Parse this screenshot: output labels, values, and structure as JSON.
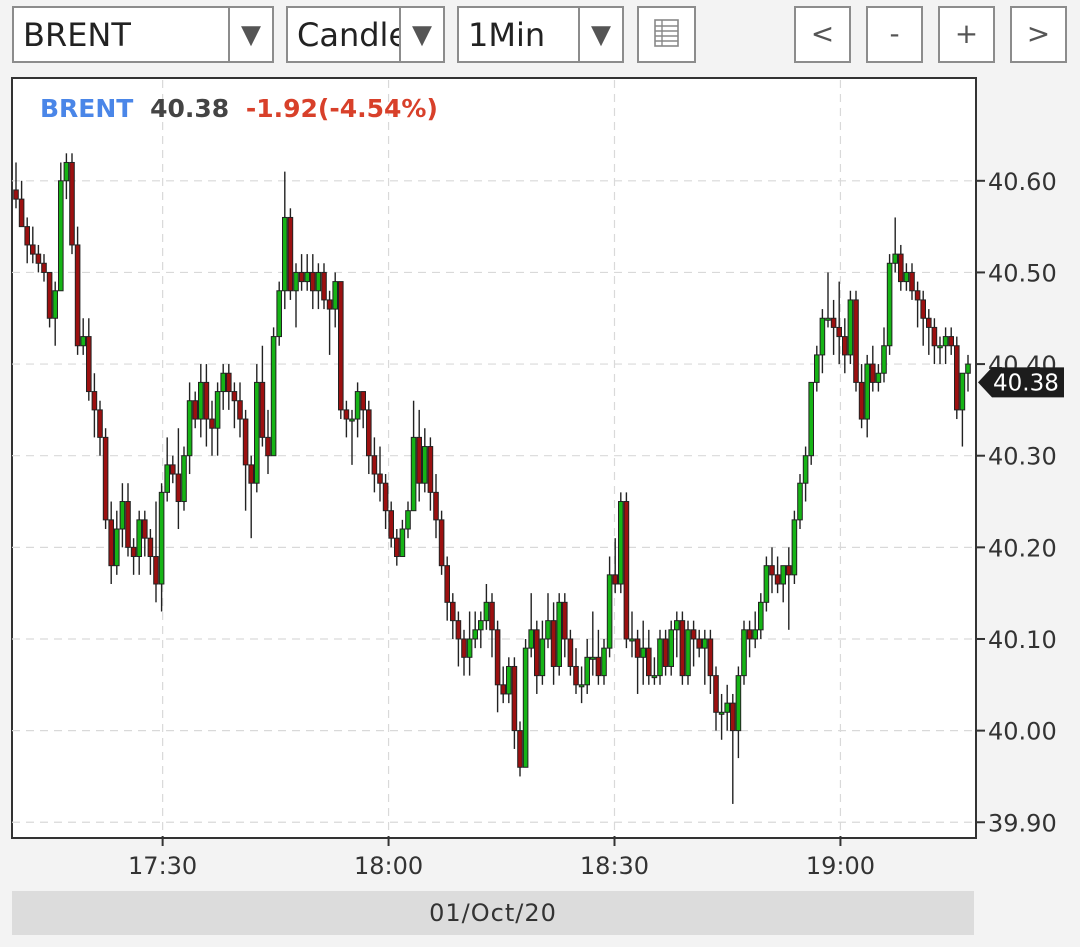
{
  "toolbar": {
    "symbol": "BRENT",
    "chart_type": "Candle",
    "interval": "1Min",
    "nav": {
      "prev": "<",
      "zoom_out": "-",
      "zoom_in": "+",
      "next": ">"
    },
    "dropdown_glyph": "▼"
  },
  "header": {
    "symbol": "BRENT",
    "price": "40.38",
    "change": "-1.92(-4.54%)"
  },
  "date_label": "01/Oct/20",
  "colors": {
    "up": "#16b416",
    "down": "#9c1010",
    "symbol": "#4a86e8",
    "change": "#d8402a",
    "price": "#444444"
  },
  "icons": {
    "table": "table-icon",
    "dropdown": "chevron-down-icon"
  },
  "chart_data": {
    "type": "candlestick",
    "symbol": "BRENT",
    "last_price": 40.38,
    "last_price_label": "40.38",
    "x_ticks": [
      "17:30",
      "18:00",
      "18:30",
      "19:00"
    ],
    "x_ticks_minutes": [
      1050,
      1080,
      1110,
      1140
    ],
    "x_range_minutes": [
      1030,
      1158
    ],
    "y_ticks": [
      39.9,
      40.0,
      40.1,
      40.2,
      40.3,
      40.4,
      40.5,
      40.6
    ],
    "y_tick_labels": [
      "39.90",
      "40.00",
      "40.10",
      "40.20",
      "40.30",
      "40.40",
      "40.50",
      "40.60"
    ],
    "ylim": [
      39.885,
      40.71
    ],
    "grid": true,
    "candles": [
      [
        40.59,
        40.62,
        40.57,
        40.58
      ],
      [
        40.58,
        40.6,
        40.55,
        40.55
      ],
      [
        40.55,
        40.56,
        40.51,
        40.53
      ],
      [
        40.53,
        40.55,
        40.51,
        40.52
      ],
      [
        40.52,
        40.53,
        40.5,
        40.51
      ],
      [
        40.51,
        40.52,
        40.49,
        40.5
      ],
      [
        40.5,
        40.5,
        40.44,
        40.45
      ],
      [
        40.45,
        40.49,
        40.42,
        40.48
      ],
      [
        40.48,
        40.62,
        40.48,
        40.6
      ],
      [
        40.6,
        40.63,
        40.58,
        40.62
      ],
      [
        40.62,
        40.63,
        40.52,
        40.53
      ],
      [
        40.53,
        40.55,
        40.41,
        40.42
      ],
      [
        40.42,
        40.45,
        40.41,
        40.43
      ],
      [
        40.43,
        40.45,
        40.36,
        40.37
      ],
      [
        40.37,
        40.39,
        40.32,
        40.35
      ],
      [
        40.35,
        40.36,
        40.3,
        40.32
      ],
      [
        40.32,
        40.33,
        40.22,
        40.23
      ],
      [
        40.23,
        40.25,
        40.16,
        40.18
      ],
      [
        40.18,
        40.24,
        40.17,
        40.22
      ],
      [
        40.22,
        40.27,
        40.2,
        40.25
      ],
      [
        40.25,
        40.27,
        40.19,
        40.2
      ],
      [
        40.2,
        40.21,
        40.17,
        40.19
      ],
      [
        40.19,
        40.24,
        40.17,
        40.23
      ],
      [
        40.23,
        40.24,
        40.19,
        40.21
      ],
      [
        40.21,
        40.22,
        40.17,
        40.19
      ],
      [
        40.19,
        40.25,
        40.14,
        40.16
      ],
      [
        40.16,
        40.27,
        40.13,
        40.26
      ],
      [
        40.26,
        40.32,
        40.25,
        40.29
      ],
      [
        40.29,
        40.3,
        40.27,
        40.28
      ],
      [
        40.28,
        40.33,
        40.22,
        40.25
      ],
      [
        40.25,
        40.31,
        40.24,
        40.3
      ],
      [
        40.3,
        40.38,
        40.28,
        40.36
      ],
      [
        40.36,
        40.37,
        40.33,
        40.34
      ],
      [
        40.34,
        40.4,
        40.32,
        40.38
      ],
      [
        40.38,
        40.4,
        40.31,
        40.34
      ],
      [
        40.34,
        40.36,
        40.3,
        40.33
      ],
      [
        40.33,
        40.38,
        40.3,
        40.37
      ],
      [
        40.37,
        40.4,
        40.35,
        40.39
      ],
      [
        40.39,
        40.4,
        40.35,
        40.37
      ],
      [
        40.37,
        40.38,
        40.33,
        40.36
      ],
      [
        40.36,
        40.38,
        40.32,
        40.34
      ],
      [
        40.34,
        40.35,
        40.24,
        40.29
      ],
      [
        40.29,
        40.3,
        40.21,
        40.27
      ],
      [
        40.27,
        40.4,
        40.26,
        40.38
      ],
      [
        40.38,
        40.42,
        40.31,
        40.32
      ],
      [
        40.32,
        40.35,
        40.28,
        40.3
      ],
      [
        40.3,
        40.44,
        40.3,
        40.43
      ],
      [
        40.43,
        40.49,
        40.42,
        40.48
      ],
      [
        40.48,
        40.61,
        40.46,
        40.56
      ],
      [
        40.56,
        40.57,
        40.47,
        40.48
      ],
      [
        40.48,
        40.51,
        40.44,
        40.5
      ],
      [
        40.5,
        40.52,
        40.48,
        40.49
      ],
      [
        40.49,
        40.52,
        40.48,
        40.5
      ],
      [
        40.5,
        40.52,
        40.46,
        40.48
      ],
      [
        40.48,
        40.51,
        40.46,
        40.5
      ],
      [
        40.5,
        40.51,
        40.46,
        40.47
      ],
      [
        40.47,
        40.48,
        40.41,
        40.46
      ],
      [
        40.46,
        40.5,
        40.44,
        40.49
      ],
      [
        40.49,
        40.49,
        40.34,
        40.35
      ],
      [
        40.35,
        40.36,
        40.32,
        40.34
      ],
      [
        40.34,
        40.35,
        40.29,
        40.34
      ],
      [
        40.34,
        40.38,
        40.32,
        40.37
      ],
      [
        40.37,
        40.37,
        40.33,
        40.35
      ],
      [
        40.35,
        40.36,
        40.28,
        40.3
      ],
      [
        40.3,
        40.32,
        40.26,
        40.28
      ],
      [
        40.28,
        40.31,
        40.25,
        40.27
      ],
      [
        40.27,
        40.28,
        40.22,
        40.24
      ],
      [
        40.24,
        40.25,
        40.2,
        40.21
      ],
      [
        40.21,
        40.22,
        40.18,
        40.19
      ],
      [
        40.19,
        40.23,
        40.19,
        40.22
      ],
      [
        40.22,
        40.25,
        40.21,
        40.24
      ],
      [
        40.24,
        40.36,
        40.24,
        40.32
      ],
      [
        40.32,
        40.35,
        40.25,
        40.27
      ],
      [
        40.27,
        40.33,
        40.26,
        40.31
      ],
      [
        40.31,
        40.32,
        40.24,
        40.26
      ],
      [
        40.26,
        40.28,
        40.21,
        40.23
      ],
      [
        40.23,
        40.24,
        40.17,
        40.18
      ],
      [
        40.18,
        40.19,
        40.12,
        40.14
      ],
      [
        40.14,
        40.15,
        40.1,
        40.12
      ],
      [
        40.12,
        40.13,
        40.07,
        40.1
      ],
      [
        40.1,
        40.11,
        40.06,
        40.08
      ],
      [
        40.08,
        40.13,
        40.06,
        40.1
      ],
      [
        40.1,
        40.13,
        40.09,
        40.11
      ],
      [
        40.11,
        40.13,
        40.09,
        40.12
      ],
      [
        40.12,
        40.16,
        40.11,
        40.14
      ],
      [
        40.14,
        40.15,
        40.08,
        40.11
      ],
      [
        40.11,
        40.12,
        40.02,
        40.05
      ],
      [
        40.05,
        40.07,
        40.03,
        40.04
      ],
      [
        40.04,
        40.08,
        40.03,
        40.07
      ],
      [
        40.07,
        40.08,
        39.98,
        40.0
      ],
      [
        40.0,
        40.01,
        39.95,
        39.96
      ],
      [
        39.96,
        40.1,
        39.96,
        40.09
      ],
      [
        40.09,
        40.15,
        40.08,
        40.11
      ],
      [
        40.11,
        40.12,
        40.04,
        40.06
      ],
      [
        40.06,
        40.12,
        40.05,
        40.1
      ],
      [
        40.1,
        40.15,
        40.09,
        40.12
      ],
      [
        40.12,
        40.14,
        40.05,
        40.07
      ],
      [
        40.07,
        40.15,
        40.06,
        40.14
      ],
      [
        40.14,
        40.15,
        40.08,
        40.1
      ],
      [
        40.1,
        40.11,
        40.06,
        40.07
      ],
      [
        40.07,
        40.09,
        40.04,
        40.05
      ],
      [
        40.05,
        40.07,
        40.03,
        40.05
      ],
      [
        40.05,
        40.1,
        40.04,
        40.08
      ],
      [
        40.08,
        40.13,
        40.06,
        40.08
      ],
      [
        40.08,
        40.11,
        40.05,
        40.06
      ],
      [
        40.06,
        40.1,
        40.05,
        40.09
      ],
      [
        40.09,
        40.19,
        40.08,
        40.17
      ],
      [
        40.17,
        40.21,
        40.15,
        40.16
      ],
      [
        40.16,
        40.26,
        40.15,
        40.25
      ],
      [
        40.25,
        40.26,
        40.09,
        40.1
      ],
      [
        40.1,
        40.13,
        40.08,
        40.1
      ],
      [
        40.1,
        40.11,
        40.04,
        40.08
      ],
      [
        40.08,
        40.12,
        40.05,
        40.09
      ],
      [
        40.09,
        40.11,
        40.05,
        40.06
      ],
      [
        40.06,
        40.08,
        40.05,
        40.06
      ],
      [
        40.06,
        40.11,
        40.05,
        40.1
      ],
      [
        40.1,
        40.11,
        40.06,
        40.07
      ],
      [
        40.07,
        40.12,
        40.06,
        40.11
      ],
      [
        40.11,
        40.13,
        40.08,
        40.12
      ],
      [
        40.12,
        40.13,
        40.05,
        40.06
      ],
      [
        40.06,
        40.12,
        40.05,
        40.11
      ],
      [
        40.11,
        40.12,
        40.07,
        40.1
      ],
      [
        40.1,
        40.11,
        40.08,
        40.09
      ],
      [
        40.09,
        40.11,
        40.05,
        40.1
      ],
      [
        40.1,
        40.11,
        40.04,
        40.06
      ],
      [
        40.06,
        40.07,
        40.0,
        40.02
      ],
      [
        40.02,
        40.04,
        39.99,
        40.02
      ],
      [
        40.02,
        40.05,
        40.0,
        40.03
      ],
      [
        40.03,
        40.04,
        39.92,
        40.0
      ],
      [
        40.0,
        40.07,
        39.97,
        40.06
      ],
      [
        40.06,
        40.12,
        40.05,
        40.11
      ],
      [
        40.11,
        40.12,
        40.08,
        40.1
      ],
      [
        40.1,
        40.13,
        40.09,
        40.11
      ],
      [
        40.11,
        40.15,
        40.1,
        40.14
      ],
      [
        40.14,
        40.19,
        40.13,
        40.18
      ],
      [
        40.18,
        40.2,
        40.15,
        40.17
      ],
      [
        40.17,
        40.19,
        40.15,
        40.16
      ],
      [
        40.16,
        40.18,
        40.14,
        40.18
      ],
      [
        40.18,
        40.2,
        40.11,
        40.17
      ],
      [
        40.17,
        40.24,
        40.16,
        40.23
      ],
      [
        40.23,
        40.28,
        40.22,
        40.27
      ],
      [
        40.27,
        40.31,
        40.25,
        40.3
      ],
      [
        40.3,
        40.38,
        40.29,
        40.38
      ],
      [
        40.38,
        40.42,
        40.37,
        40.41
      ],
      [
        40.41,
        40.46,
        40.39,
        40.45
      ],
      [
        40.45,
        40.5,
        40.44,
        40.45
      ],
      [
        40.45,
        40.47,
        40.41,
        40.44
      ],
      [
        40.44,
        40.49,
        40.4,
        40.43
      ],
      [
        40.43,
        40.45,
        40.39,
        40.41
      ],
      [
        40.41,
        40.48,
        40.4,
        40.47
      ],
      [
        40.47,
        40.48,
        40.37,
        40.38
      ],
      [
        40.38,
        40.4,
        40.33,
        40.34
      ],
      [
        40.34,
        40.41,
        40.32,
        40.4
      ],
      [
        40.4,
        40.42,
        40.37,
        40.38
      ],
      [
        40.38,
        40.4,
        40.37,
        40.39
      ],
      [
        40.39,
        40.44,
        40.38,
        40.42
      ],
      [
        40.42,
        40.52,
        40.41,
        40.51
      ],
      [
        40.51,
        40.56,
        40.5,
        40.52
      ],
      [
        40.52,
        40.53,
        40.48,
        40.49
      ],
      [
        40.49,
        40.51,
        40.48,
        40.5
      ],
      [
        40.5,
        40.51,
        40.47,
        40.48
      ],
      [
        40.48,
        40.49,
        40.44,
        40.47
      ],
      [
        40.47,
        40.48,
        40.42,
        40.45
      ],
      [
        40.45,
        40.46,
        40.41,
        40.44
      ],
      [
        40.44,
        40.45,
        40.4,
        40.42
      ],
      [
        40.42,
        40.43,
        40.4,
        40.42
      ],
      [
        40.42,
        40.44,
        40.4,
        40.43
      ],
      [
        40.43,
        40.44,
        40.41,
        40.42
      ],
      [
        40.42,
        40.43,
        40.34,
        40.35
      ],
      [
        40.35,
        40.39,
        40.31,
        40.39
      ],
      [
        40.39,
        40.41,
        40.37,
        40.4
      ]
    ]
  }
}
